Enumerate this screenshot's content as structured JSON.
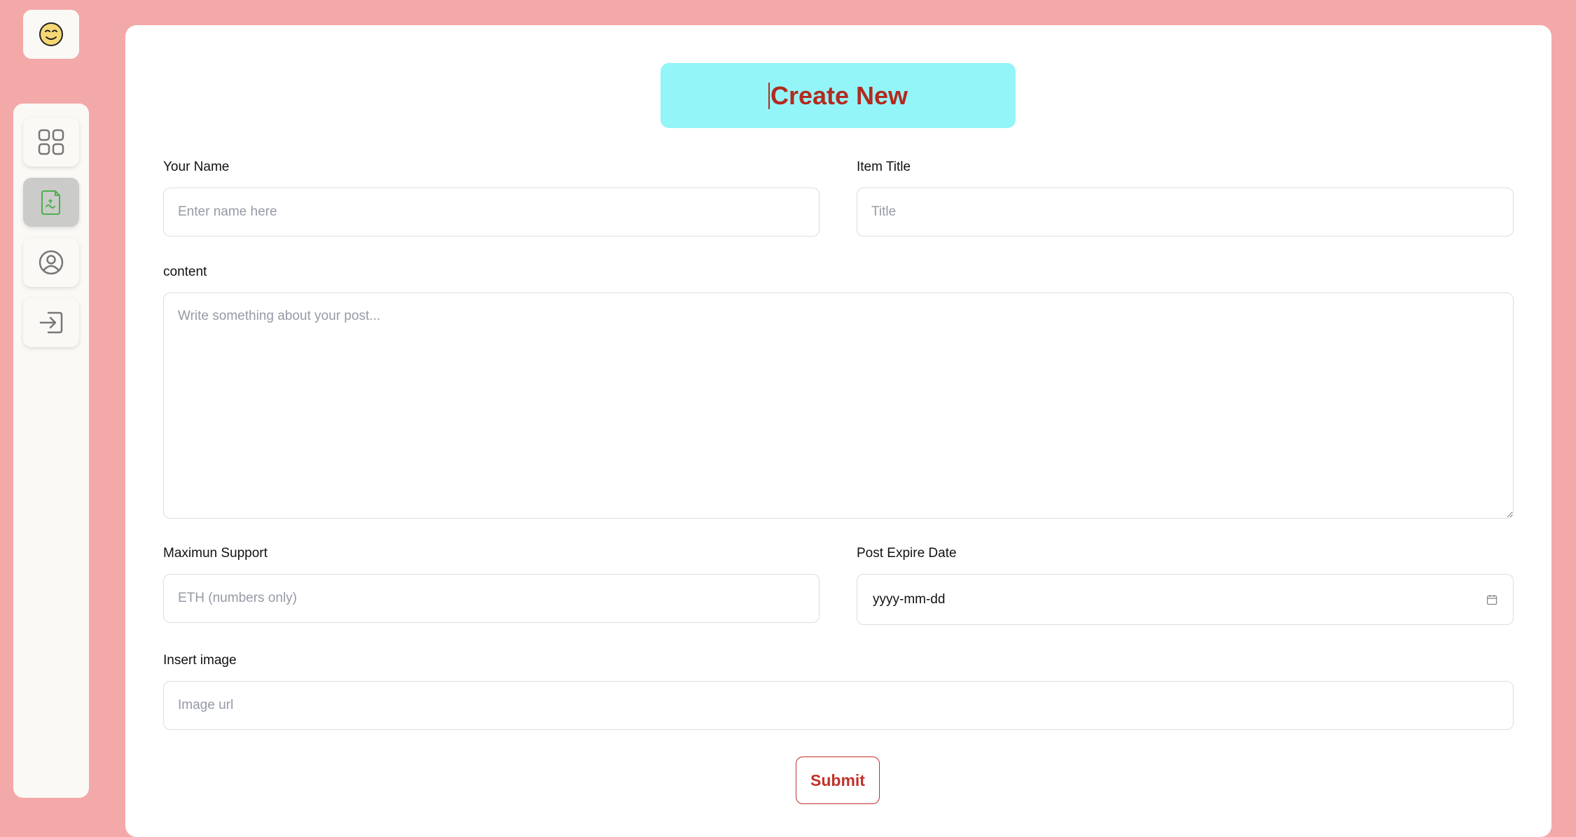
{
  "sidebar": {
    "logo_icon": "smiley-face-icon",
    "items": [
      {
        "icon": "grid-icon",
        "name": "dashboard"
      },
      {
        "icon": "document-icon",
        "name": "create-post",
        "active": true
      },
      {
        "icon": "user-circle-icon",
        "name": "profile"
      },
      {
        "icon": "sign-in-icon",
        "name": "logout"
      }
    ]
  },
  "form": {
    "title": "Create New",
    "name_label": "Your Name",
    "name_placeholder": "Enter name here",
    "title_label": "Item Title",
    "title_placeholder": "Title",
    "content_label": "content",
    "content_placeholder": "Write something about your post...",
    "support_label": "Maximun Support",
    "support_placeholder": "ETH (numbers only)",
    "date_label": "Post Expire Date",
    "date_value": "yyyy-mm-dd",
    "image_label": "Insert image",
    "image_placeholder": "Image url",
    "submit_label": "Submit"
  },
  "colors": {
    "background": "#f2a9a8",
    "header_button": "#93f5f8",
    "accent": "#b32a1f",
    "active_nav": "#cbcbc9"
  }
}
